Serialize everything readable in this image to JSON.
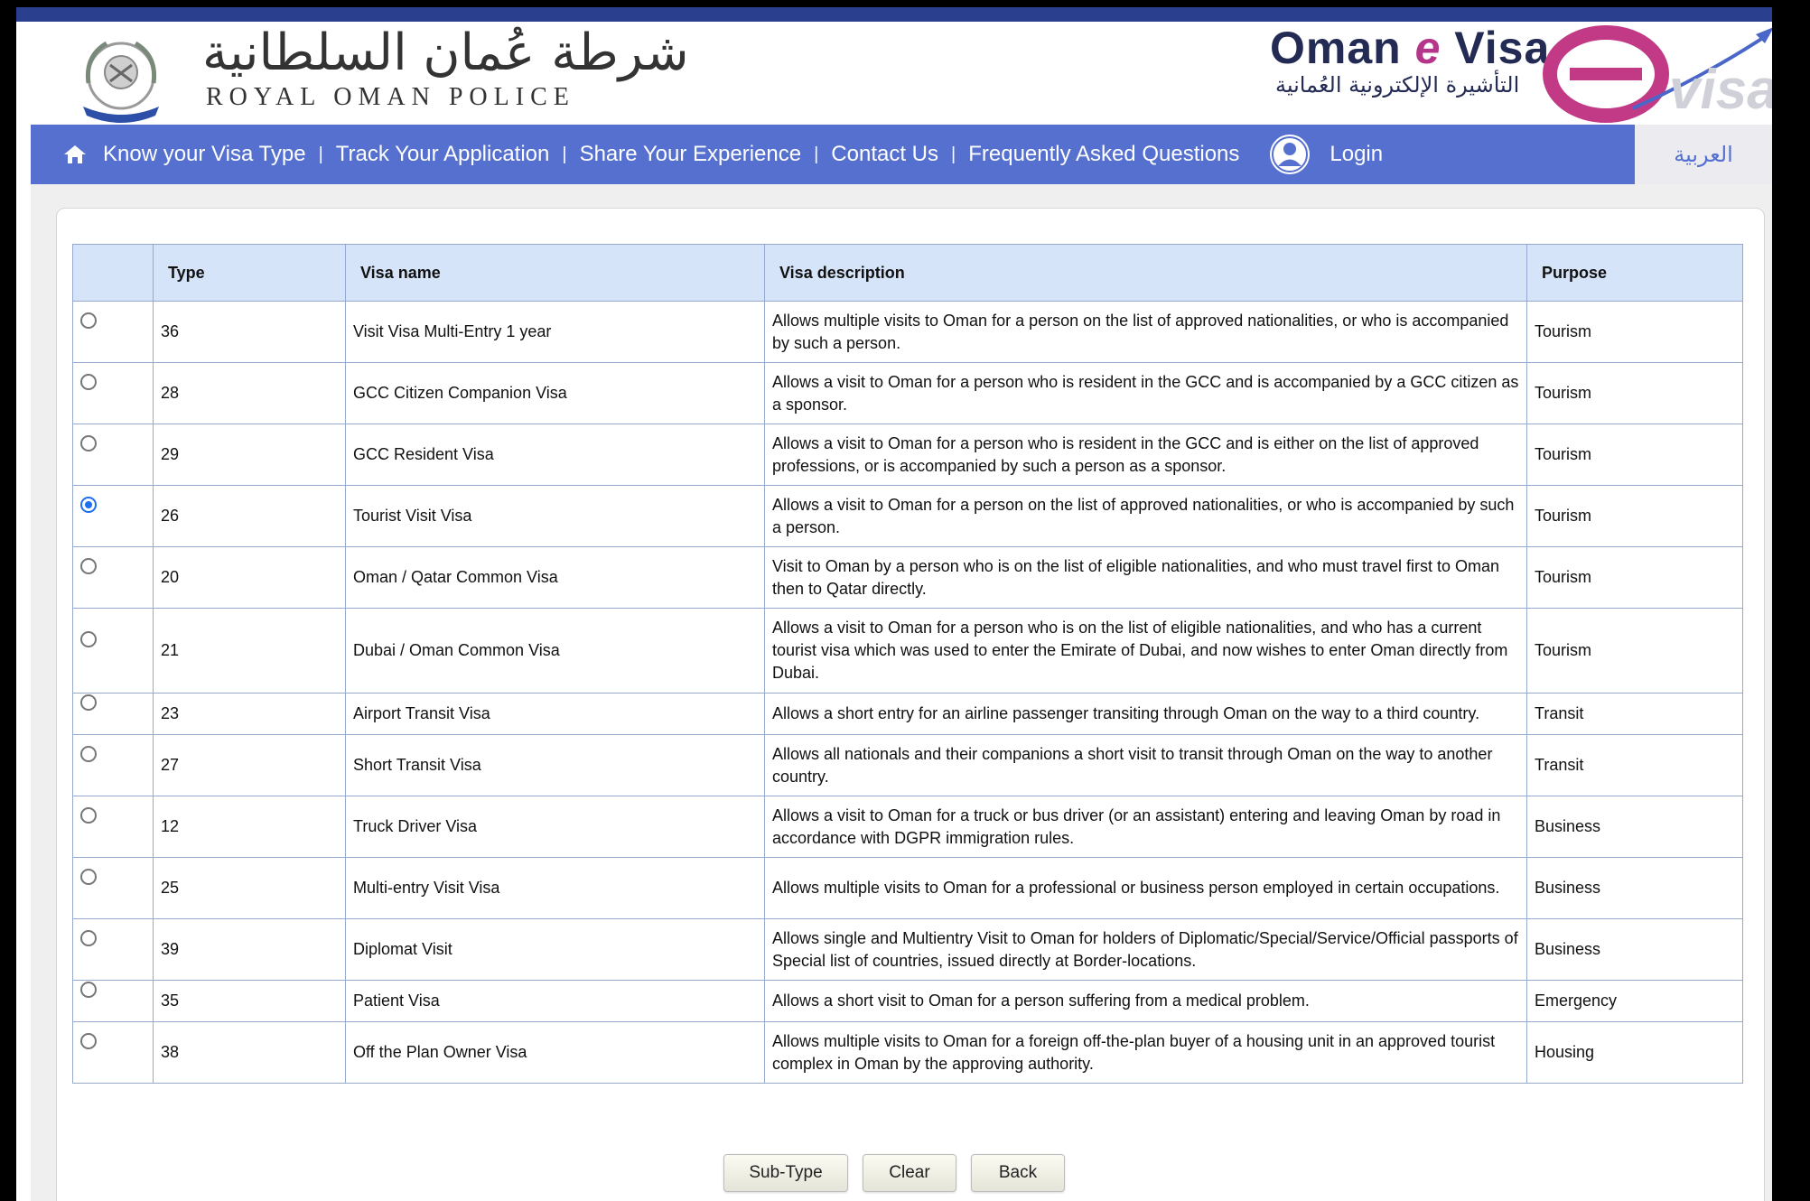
{
  "header": {
    "rop_arabic": "شرطة عُمان السلطانية",
    "rop_english": "ROYAL OMAN POLICE",
    "evisa_title_prefix": "Oman ",
    "evisa_title_e": "e",
    "evisa_title_suffix": " Visa",
    "evisa_arabic": "التأشيرة الإلكترونية العُمانية",
    "logo_text": "visa"
  },
  "nav": {
    "items": [
      {
        "label": "Know your Visa Type"
      },
      {
        "label": "Track Your Application"
      },
      {
        "label": "Share Your Experience"
      },
      {
        "label": "Contact Us"
      },
      {
        "label": "Frequently Asked Questions"
      }
    ],
    "login_label": "Login",
    "separator": "|",
    "language_label": "العربية"
  },
  "table": {
    "headers": {
      "type": "Type",
      "name": "Visa name",
      "description": "Visa description",
      "purpose": "Purpose"
    },
    "rows": [
      {
        "type": "36",
        "name": "Visit Visa Multi-Entry 1 year",
        "description": "Allows multiple visits to Oman for a person on the list of approved nationalities, or who is accompanied by such a person.",
        "purpose": "Tourism",
        "selected": false
      },
      {
        "type": "28",
        "name": "GCC Citizen Companion Visa",
        "description": "Allows a visit to Oman for a person who is resident in the GCC and is accompanied by a GCC citizen as a sponsor.",
        "purpose": "Tourism",
        "selected": false
      },
      {
        "type": "29",
        "name": "GCC Resident Visa",
        "description": "Allows a visit to Oman for a person who is resident in the GCC and is either on the list of approved professions, or is accompanied by such a person as a sponsor.",
        "purpose": "Tourism",
        "selected": false
      },
      {
        "type": "26",
        "name": "Tourist Visit Visa",
        "description": "Allows a visit to Oman for a person on the list of approved nationalities, or who is accompanied by such a person.",
        "purpose": "Tourism",
        "selected": true
      },
      {
        "type": "20",
        "name": "Oman / Qatar Common Visa",
        "description": "Visit to Oman by a person who is on the list of eligible nationalities, and who must travel first to Oman then to Qatar directly.",
        "purpose": "Tourism",
        "selected": false
      },
      {
        "type": "21",
        "name": "Dubai / Oman Common Visa",
        "description": "Allows a visit to Oman for a person who is on the list of eligible nationalities, and who has a current tourist visa which was used to enter the Emirate of Dubai, and now wishes to enter Oman directly from Dubai.",
        "purpose": "Tourism",
        "selected": false
      },
      {
        "type": "23",
        "name": "Airport Transit Visa",
        "description": "Allows a short entry for an airline passenger transiting through Oman on the way to a third country.",
        "purpose": "Transit",
        "selected": false
      },
      {
        "type": "27",
        "name": "Short Transit Visa",
        "description": "Allows all nationals and their companions a short visit to transit through Oman on the way to another country.",
        "purpose": "Transit",
        "selected": false
      },
      {
        "type": "12",
        "name": "Truck Driver Visa",
        "description": "Allows a visit to Oman for a truck or bus driver (or an assistant) entering and leaving Oman by road in accordance with DGPR immigration rules.",
        "purpose": "Business",
        "selected": false
      },
      {
        "type": "25",
        "name": "Multi-entry Visit Visa",
        "description": "Allows multiple visits to Oman for a professional or business person employed in certain occupations.",
        "purpose": "Business",
        "selected": false
      },
      {
        "type": "39",
        "name": "Diplomat Visit",
        "description": "Allows single and Multientry Visit to Oman for holders of Diplomatic/Special/Service/Official passports of Special list of countries, issued directly at Border-locations.",
        "purpose": "Business",
        "selected": false
      },
      {
        "type": "35",
        "name": "Patient Visa",
        "description": "Allows a short visit to Oman for a person suffering from a medical problem.",
        "purpose": "Emergency",
        "selected": false
      },
      {
        "type": "38",
        "name": "Off the Plan Owner Visa",
        "description": "Allows multiple visits to Oman for a foreign off-the-plan buyer of a housing unit in an approved tourist complex in Oman by the approving authority.",
        "purpose": "Housing",
        "selected": false
      }
    ]
  },
  "buttons": {
    "subtype": "Sub-Type",
    "clear": "Clear",
    "back": "Back"
  },
  "colors": {
    "nav": "#5570cf",
    "header_row": "#d6e4fa",
    "radio_selected": "#1c6ef2",
    "brand_dark": "#232b55",
    "brand_magenta": "#b5358a"
  }
}
